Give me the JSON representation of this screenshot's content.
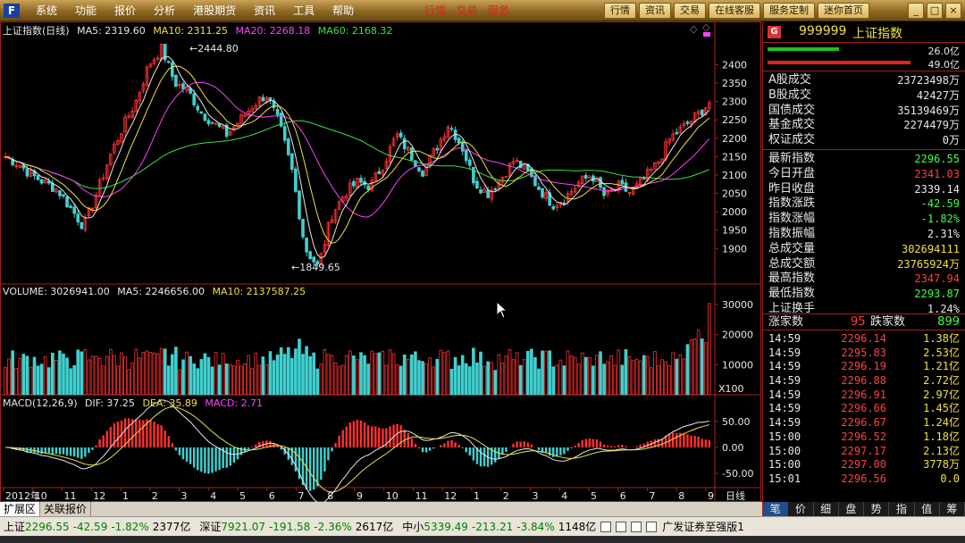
{
  "app": {
    "logo": "F",
    "menu": [
      "系统",
      "功能",
      "报价",
      "分析",
      "港股期货",
      "资讯",
      "工具",
      "帮助"
    ],
    "marquee": "行情 · 交易 · 服务",
    "top_buttons": [
      "行情",
      "资讯",
      "交易",
      "在线客服",
      "服务定制",
      "迷你首页"
    ],
    "window_controls": [
      "_",
      "□",
      "×"
    ]
  },
  "chart": {
    "legend_main": {
      "title": "上证指数(日线)",
      "ma5": "MA5: 2319.60",
      "ma10": "MA10: 2311.25",
      "ma20": "MA20: 2268.18",
      "ma60": "MA60: 2168.32"
    },
    "legend_volume": {
      "title": "VOLUME: 3026941.00",
      "ma5": "MA5: 2246656.00",
      "ma10": "MA10: 2137587.25"
    },
    "legend_macd": {
      "title": "MACD(12,26,9)",
      "dif": "DIF: 37.25",
      "dea": "DEA: 35.89",
      "macd": "MACD: 2.71"
    },
    "price_ticks": [
      "2400",
      "2350",
      "2300",
      "2250",
      "2200",
      "2150",
      "2100",
      "2050",
      "2000",
      "1950",
      "1900"
    ],
    "volume_ticks": [
      "30000",
      "20000",
      "10000"
    ],
    "volume_unit": "X100",
    "macd_ticks": [
      "50.00",
      "0.00",
      "-50.00"
    ],
    "high_mark": "2444.80",
    "low_mark": "1849.65",
    "x_labels": [
      "2012年",
      "10",
      "11",
      "12",
      "1",
      "2",
      "3",
      "4",
      "5",
      "6",
      "7",
      "8",
      "9",
      "10",
      "11",
      "12",
      "1",
      "2",
      "3",
      "4",
      "5",
      "6",
      "7",
      "8",
      "9"
    ],
    "period": "日线"
  },
  "chart_data": {
    "type": "candlestick",
    "title": "上证指数(日线)",
    "ylim": [
      1849.65,
      2444.8
    ],
    "price_path_approx": [
      2150,
      2130,
      2100,
      2080,
      2060,
      2010,
      1960,
      2050,
      2150,
      2230,
      2300,
      2400,
      2444.8,
      2350,
      2330,
      2270,
      2240,
      2210,
      2250,
      2290,
      2320,
      2240,
      2110,
      1900,
      1849.65,
      1990,
      2050,
      2080,
      2070,
      2130,
      2210,
      2160,
      2110,
      2170,
      2240,
      2180,
      2080,
      2050,
      2090,
      2140,
      2110,
      2060,
      2020,
      2040,
      2080,
      2100,
      2040,
      2070,
      2050,
      2090,
      2130,
      2200,
      2230,
      2260,
      2296.55
    ],
    "ma5_last": 2319.6,
    "ma10_last": 2311.25,
    "ma20_last": 2268.18,
    "ma60_last": 2168.32,
    "volume_last": 3026941,
    "macd": {
      "dif": 37.25,
      "dea": 35.89,
      "macd": 2.71
    }
  },
  "quote_panel": {
    "badge": "G",
    "code": "999999",
    "name": "上证指数",
    "bar_top_value": "26.0亿",
    "bar_bottom_value": "49.0亿",
    "block1": [
      {
        "label": "A股成交",
        "value": "23723498万",
        "color": "#e8e8e8"
      },
      {
        "label": "B股成交",
        "value": "42427万",
        "color": "#e8e8e8"
      },
      {
        "label": "国债成交",
        "value": "35139469万",
        "color": "#e8e8e8"
      },
      {
        "label": "基金成交",
        "value": "2274479万",
        "color": "#e8e8e8"
      },
      {
        "label": "权证成交",
        "value": "0万",
        "color": "#e8e8e8"
      }
    ],
    "block2": [
      {
        "label": "最新指数",
        "value": "2296.55",
        "color": "#40ff40"
      },
      {
        "label": "今日开盘",
        "value": "2341.03",
        "color": "#ff4040"
      },
      {
        "label": "昨日收盘",
        "value": "2339.14",
        "color": "#e8e8e8"
      },
      {
        "label": "指数涨跌",
        "value": "-42.59",
        "color": "#40ff40"
      },
      {
        "label": "指数涨幅",
        "value": "-1.82%",
        "color": "#40ff40"
      },
      {
        "label": "指数振幅",
        "value": "2.31%",
        "color": "#e8e8e8"
      },
      {
        "label": "总成交量",
        "value": "302694111",
        "color": "#f0e040"
      },
      {
        "label": "总成交额",
        "value": "23765924万",
        "color": "#f0e040"
      },
      {
        "label": "最高指数",
        "value": "2347.94",
        "color": "#ff4040"
      },
      {
        "label": "最低指数",
        "value": "2293.87",
        "color": "#40ff40"
      },
      {
        "label": "上证换手",
        "value": "1.24%",
        "color": "#e8e8e8"
      }
    ],
    "up_label": "涨家数",
    "up_count": "95",
    "down_label": "跌家数",
    "down_count": "899",
    "ticks": [
      {
        "time": "14:59",
        "price": "2296.14",
        "vol": "1.38亿"
      },
      {
        "time": "14:59",
        "price": "2295.83",
        "vol": "2.53亿"
      },
      {
        "time": "14:59",
        "price": "2296.19",
        "vol": "1.21亿"
      },
      {
        "time": "14:59",
        "price": "2296.88",
        "vol": "2.72亿"
      },
      {
        "time": "14:59",
        "price": "2296.91",
        "vol": "2.97亿"
      },
      {
        "time": "14:59",
        "price": "2296.66",
        "vol": "1.45亿"
      },
      {
        "time": "14:59",
        "price": "2296.67",
        "vol": "1.24亿"
      },
      {
        "time": "15:00",
        "price": "2296.52",
        "vol": "1.18亿"
      },
      {
        "time": "15:00",
        "price": "2297.17",
        "vol": "2.13亿"
      },
      {
        "time": "15:00",
        "price": "2297.00",
        "vol": "3778万"
      },
      {
        "time": "15:01",
        "price": "2296.56",
        "vol": "0.0"
      }
    ],
    "tabs": [
      "笔",
      "价",
      "细",
      "盘",
      "势",
      "指",
      "值",
      "筹"
    ]
  },
  "bottom_tabs": [
    "扩展区",
    "关联报价"
  ],
  "status_bar": {
    "sh_label": "上证",
    "sh_price": "2296.55",
    "sh_change": "-42.59",
    "sh_pct": "-1.82%",
    "sh_amount": "2377亿",
    "sz_label": "深证",
    "sz_price": "7921.07",
    "sz_change": "-191.58",
    "sz_pct": "-2.36%",
    "sz_amount": "2617亿",
    "zx_label": "中小",
    "zx_price": "5339.49",
    "zx_change": "-213.21",
    "zx_pct": "-3.84%",
    "zx_amount": "1148亿",
    "broker": "广发证券至强版1"
  },
  "colors": {
    "up": "#ff3030",
    "down": "#40d0d0",
    "ma5": "#e8e8e8",
    "ma10": "#f0e040",
    "ma20": "#ff40ff",
    "ma60": "#40e040",
    "grid_red": "#a02020"
  }
}
